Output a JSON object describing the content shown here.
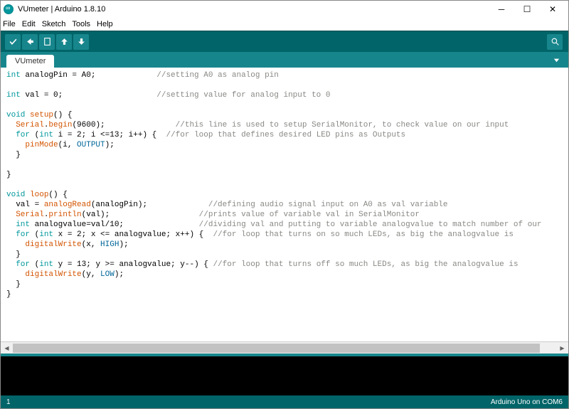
{
  "window": {
    "title": "VUmeter | Arduino 1.8.10"
  },
  "menus": {
    "file": "File",
    "edit": "Edit",
    "sketch": "Sketch",
    "tools": "Tools",
    "help": "Help"
  },
  "tab": {
    "name": "VUmeter"
  },
  "code": {
    "l1a": "int",
    "l1b": " analogPin = A0;             ",
    "l1c": "//setting A0 as analog pin",
    "l2": "",
    "l3a": "int",
    "l3b": " val = 0;                    ",
    "l3c": "//setting value for analog input to 0",
    "l4": "",
    "l5a": "void",
    "l5b": " ",
    "l5c": "setup",
    "l5d": "() {",
    "l6a": "  ",
    "l6b": "Serial",
    "l6c": ".",
    "l6d": "begin",
    "l6e": "(9600);               ",
    "l6f": "//this line is used to setup SerialMonitor, to check value on our input",
    "l7a": "  ",
    "l7b": "for",
    "l7c": " (",
    "l7d": "int",
    "l7e": " i = 2; i <=13; i++) {  ",
    "l7f": "//for loop that defines desired LED pins as Outputs",
    "l8a": "    ",
    "l8b": "pinMode",
    "l8c": "(i, ",
    "l8d": "OUTPUT",
    "l8e": ");",
    "l9": "  }",
    "l10": "",
    "l11": "}",
    "l12": "",
    "l13a": "void",
    "l13b": " ",
    "l13c": "loop",
    "l13d": "() {",
    "l14a": "  val = ",
    "l14b": "analogRead",
    "l14c": "(analogPin);             ",
    "l14d": "//defining audio signal input on A0 as val variable",
    "l15a": "  ",
    "l15b": "Serial",
    "l15c": ".",
    "l15d": "println",
    "l15e": "(val);                   ",
    "l15f": "//prints value of variable val in SerialMonitor",
    "l16a": "  ",
    "l16b": "int",
    "l16c": " analogvalue=val/10;                ",
    "l16d": "//dividing val and putting to variable analogvalue to match number of our",
    "l17a": "  ",
    "l17b": "for",
    "l17c": " (",
    "l17d": "int",
    "l17e": " x = 2; x <= analogvalue; x++) {  ",
    "l17f": "//for loop that turns on so much LEDs, as big the analogvalue is",
    "l18a": "    ",
    "l18b": "digitalWrite",
    "l18c": "(x, ",
    "l18d": "HIGH",
    "l18e": ");",
    "l19": "  }",
    "l20a": "  ",
    "l20b": "for",
    "l20c": " (",
    "l20d": "int",
    "l20e": " y = 13; y >= analogvalue; y--) { ",
    "l20f": "//for loop that turns off so much LEDs, as big the analogvalue is",
    "l21a": "    ",
    "l21b": "digitalWrite",
    "l21c": "(y, ",
    "l21d": "LOW",
    "l21e": ");",
    "l22": "  }",
    "l23": "}"
  },
  "status": {
    "left": "1",
    "right": "Arduino Uno on COM6"
  }
}
